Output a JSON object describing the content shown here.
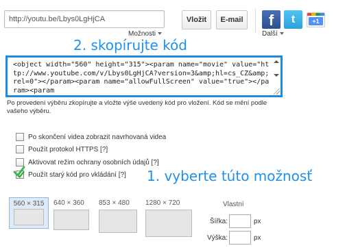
{
  "share": {
    "url_value": "http://youtu.be/Lbys0LgHjCA",
    "options_label": "Možnosti",
    "embed_button": "Vložit",
    "email_button": "E-mail",
    "more_label": "Další",
    "facebook_glyph": "f",
    "twitter_glyph": "t",
    "gplus_label": "+1"
  },
  "annotations": {
    "step2": "2. skopírujte kód",
    "step1": "1. vyberte túto možnosť",
    "color": "#1e90ee"
  },
  "embed": {
    "code": "<object width=\"560\" height=\"315\"><param name=\"movie\" value=\"http://www.youtube.com/v/Lbys0LgHjCA?version=3&amp;hl=cs_CZ&amp;rel=0\"></param><param name=\"allowFullScreen\" value=\"true\"></param><param",
    "help_text": "Po provedení výběru zkopírujte a vložte výše uvedený kód pro vložení. Kód se mění podle vašeho výběru."
  },
  "options": [
    {
      "label": "Po skončení videa zobrazit navrhovaná videa",
      "checked": false
    },
    {
      "label": "Použít protokol HTTPS [?]",
      "checked": false
    },
    {
      "label": "Aktivovat režim ochrany osobních údajů [?]",
      "checked": false
    },
    {
      "label": "Použít starý kód pro vkládání [?]",
      "checked": true
    }
  ],
  "sizes": [
    {
      "label": "560 × 315",
      "selected": true
    },
    {
      "label": "640 × 360",
      "selected": false
    },
    {
      "label": "853 × 480",
      "selected": false
    },
    {
      "label": "1280 × 720",
      "selected": false
    }
  ],
  "custom_size": {
    "label": "Vlastní",
    "width_label": "Šířka:",
    "height_label": "Výška:",
    "unit": "px",
    "width_value": "",
    "height_value": ""
  }
}
